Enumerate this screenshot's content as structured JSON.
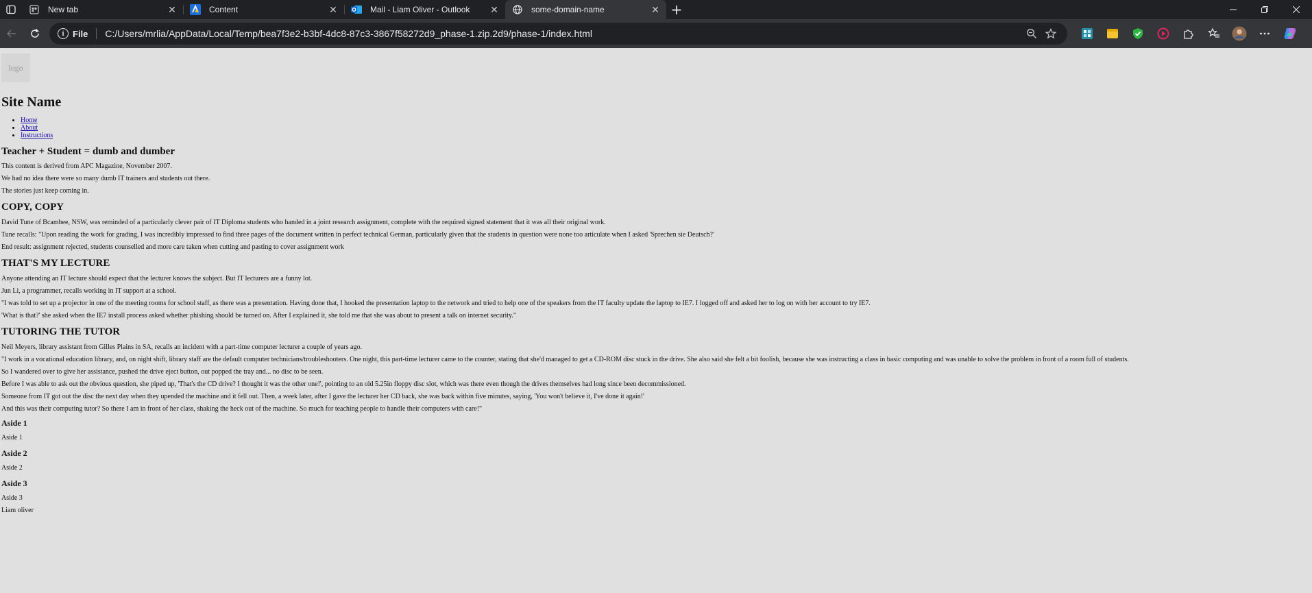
{
  "browser": {
    "tabs": [
      {
        "title": "New tab",
        "icon": "newtab-icon"
      },
      {
        "title": "Content",
        "icon": "content-app-icon"
      },
      {
        "title": "Mail - Liam Oliver - Outlook",
        "icon": "outlook-icon"
      },
      {
        "title": "some-domain-name",
        "icon": "globe-icon",
        "active": true
      }
    ],
    "address": {
      "scheme": "File",
      "url": "C:/Users/mrlia/AppData/Local/Temp/bea7f3e2-b3bf-4dc8-87c3-3867f58272d9_phase-1.zip.2d9/phase-1/index.html"
    },
    "colors": {
      "tabbar": "#202124",
      "toolbar": "#35363a",
      "page_bg": "#e0e0e0",
      "link": "#1a0dab"
    }
  },
  "site": {
    "logo": "logo",
    "name": "Site Name",
    "nav": [
      "Home",
      "About",
      "Instructions"
    ]
  },
  "article": {
    "title": "Teacher + Student = dumb and dumber",
    "intro": [
      "This content is derived from APC Magazine, November 2007.",
      "We had no idea there were so many dumb IT trainers and students out there.",
      "The stories just keep coming in."
    ],
    "sections": [
      {
        "heading": "COPY, COPY",
        "paras": [
          "David Tune of Bcambee, NSW, was reminded of a particularly clever pair of IT Diploma students who handed in a joint research assignment, complete with the required signed statement that it was all their original work.",
          "Tune recalls: \"Upon reading the work for grading, I was incredibly impressed to find three pages of the document written in perfect technical German, particularly given that the students in question were none too articulate when I asked 'Sprechen sie Deutsch?'",
          "End result: assignment rejected, students counselled and more care taken when cutting and pasting to cover assignment work"
        ]
      },
      {
        "heading": "THAT'S MY LECTURE",
        "paras": [
          "Anyone attending an IT lecture should expect that the lecturer knows the subject. But IT lecturers are a funny lot.",
          "Jun Li, a programmer, recalls working in IT support at a school.",
          "\"I was told to set up a projector in one of the meeting rooms for school staff, as there was a presentation. Having done that, I hooked the presentation laptop to the network and tried to help one of the speakers from the IT faculty update the laptop to IE7. I logged off and asked her to log on with her account to try IE7.",
          "'What is that?' she asked when the IE7 install process asked whether phishing should be turned on. After I explained it, she told me that she was about to present a talk on internet security.\""
        ]
      },
      {
        "heading": "TUTORING THE TUTOR",
        "paras": [
          "Neil Meyers, library assistant from Gilles Plains in SA, recalls an incident with a part-time computer lecturer a couple of years ago.",
          "\"I work in a vocational education library, and, on night shift, library staff are the default computer technicians/troubleshooters. One night, this part-time lecturer came to the counter, stating that she'd managed to get a CD-ROM disc stuck in the drive. She also said she felt a bit foolish, because she was instructing a class in basic computing and was unable to solve the problem in front of a room full of students.",
          "So I wandered over to give her assistance, pushed the drive eject button, out popped the tray and... no disc to be seen.",
          "Before I was able to ask out the obvious question, she piped up, 'That's the CD drive? I thought it was the other one!', pointing to an old 5.25in floppy disc slot, which was there even though the drives themselves had long since been decommissioned.",
          "Someone from IT got out the disc the next day when they upended the machine and it fell out. Then, a week later, after I gave the lecturer her CD back, she was back within five minutes, saying, 'You won't believe it, I've done it again!'",
          "And this was their computing tutor? So there I am in front of her class, shaking the heck out of the machine. So much for teaching people to handle their computers with care!\""
        ]
      }
    ]
  },
  "asides": [
    {
      "heading": "Aside 1",
      "text": "Aside 1"
    },
    {
      "heading": "Aside 2",
      "text": "Aside 2"
    },
    {
      "heading": "Aside 3",
      "text": "Aside 3"
    }
  ],
  "footer": {
    "author": "Liam oliver"
  }
}
